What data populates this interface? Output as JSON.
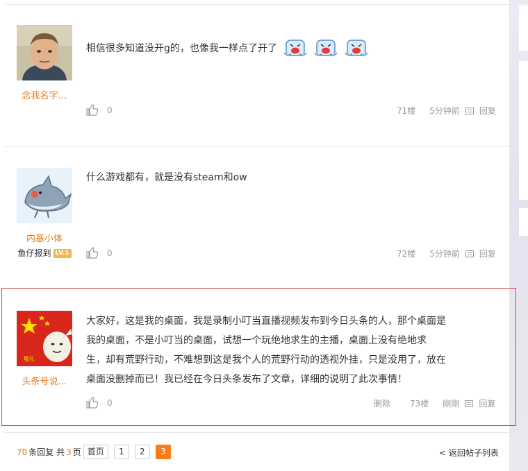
{
  "posts": [
    {
      "username": "念我名字…",
      "text": "相信很多知道没开g的，也像我一样点了开了",
      "emoji": [
        "laughing-crying-icon",
        "laughing-crying-icon",
        "laughing-crying-icon"
      ],
      "likes": "0",
      "floor": "71楼",
      "time": "5分钟前",
      "reply": "回复"
    },
    {
      "username": "内基小体",
      "badge_name": "鱼仔报到",
      "badge_level": "LV.1",
      "text": "什么游戏都有，就是没有steam和ow",
      "likes": "0",
      "floor": "72楼",
      "time": "5分钟前",
      "reply": "回复"
    },
    {
      "username": "头条号说…",
      "text_lines": [
        "大家好，这是我的桌面，我是录制小叮当直播视频发布到今日头条的人，那个桌面是",
        "我的桌面，不是小叮当的桌面，试想一个玩绝地求生的主播，桌面上没有绝地求",
        "生，却有荒野行动，不难想到这是我个人的荒野行动的透视外挂，只是没用了，放在",
        "桌面没删掉而已！我已经在今日头条发布了文章，详细的说明了此次事情！"
      ],
      "avatar_caption": "敬礼",
      "likes": "0",
      "delete": "删除",
      "floor": "73楼",
      "time": "刚刚",
      "reply": "回复"
    }
  ],
  "pager": {
    "total_replies": "70",
    "replies_label": "条回复 共",
    "total_pages": "3",
    "pages_label": "页",
    "first": "首页",
    "pages": [
      "1",
      "2",
      "3"
    ],
    "current": "3",
    "back": "< 返回帖子列表"
  },
  "colors": {
    "accent": "#e4781e",
    "highlight_border": "#d64545",
    "active_page": "#f97b16"
  }
}
